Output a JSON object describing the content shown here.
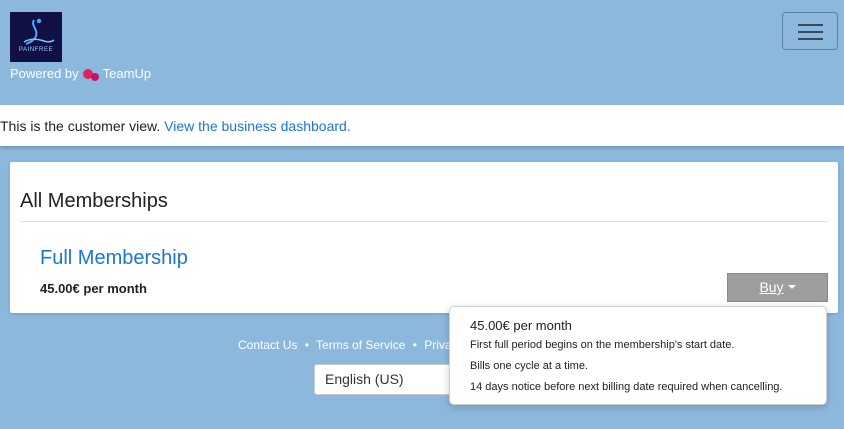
{
  "header": {
    "logo_text": "PAINFREE",
    "powered_by": "Powered by",
    "brand": "TeamUp"
  },
  "banner": {
    "text": "This is the customer view.",
    "link": "View the business dashboard."
  },
  "memberships": {
    "title": "All Memberships",
    "items": [
      {
        "name": "Full Membership",
        "price": "45.00€ per month",
        "buy_label": "Buy"
      }
    ]
  },
  "popover": {
    "title": "45.00€ per month",
    "lines": [
      "First full period begins on the membership's start date.",
      "Bills one cycle at a time.",
      "14 days notice before next billing date required when cancelling."
    ]
  },
  "footer": {
    "links": [
      "Contact Us",
      "Terms of Service",
      "Privacy"
    ],
    "separator": "•"
  },
  "language": {
    "selected": "English (US)"
  },
  "colors": {
    "background": "#8db8dd",
    "link": "#1a76d2",
    "buy_button": "#9e9e9e",
    "brand_accent": "#e0225f",
    "logo_bg": "#101044"
  }
}
